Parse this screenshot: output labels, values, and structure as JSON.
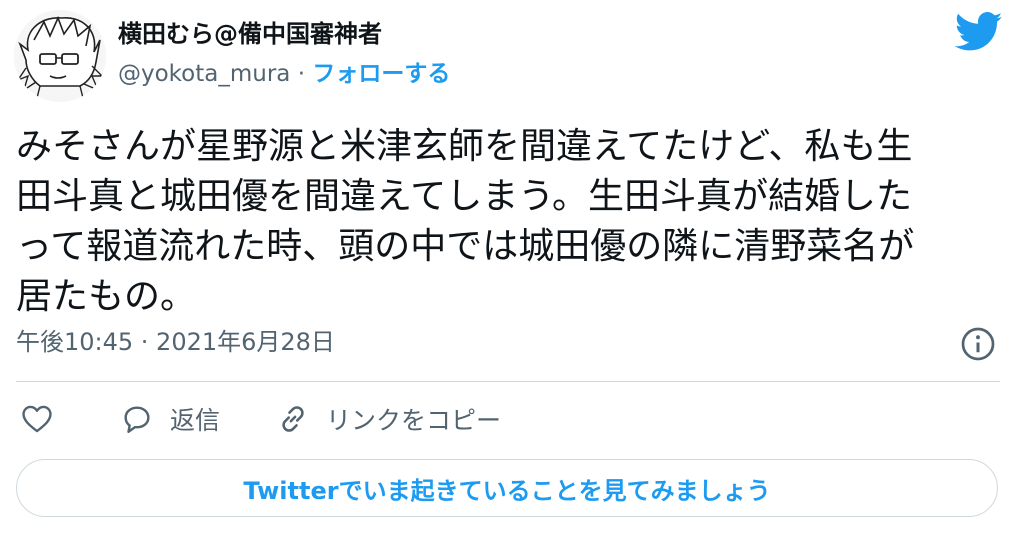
{
  "author": {
    "display_name": "横田むら@備中国審神者",
    "handle": "@yokota_mura",
    "separator": "·",
    "follow_label": "フォローする"
  },
  "tweet": {
    "text": "みそさんが星野源と米津玄師を間違えてたけど、私も生\n田斗真と城田優を間違えてしまう。生田斗真が結婚した\nって報道流れた時、頭の中では城田優の隣に清野菜名が\n居たもの。"
  },
  "meta": {
    "timestamp": "午後10:45 · 2021年6月28日"
  },
  "actions": {
    "reply_label": "返信",
    "copy_link_label": "リンクをコピー"
  },
  "cta": {
    "label": "Twitterでいま起きていることを見てみましょう"
  },
  "icons": {
    "brand": "twitter-bird-icon",
    "info": "info-icon",
    "like": "heart-icon",
    "reply": "speech-bubble-icon",
    "link": "link-icon"
  },
  "colors": {
    "accent": "#1d9bf0",
    "text": "#0f1419",
    "secondary": "#536471",
    "border": "#cfd9de"
  }
}
